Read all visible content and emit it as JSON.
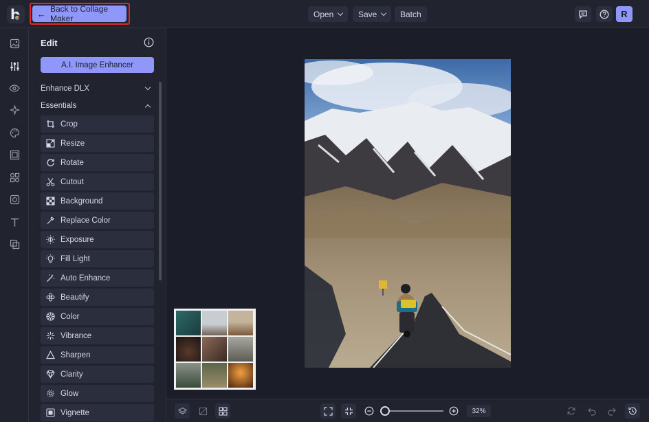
{
  "topbar": {
    "logo_letter": "b",
    "back_label": "Back to Collage Maker",
    "open_label": "Open",
    "save_label": "Save",
    "batch_label": "Batch",
    "avatar_initial": "R"
  },
  "panel": {
    "title": "Edit",
    "ai_button": "A.I. Image Enhancer",
    "sections": {
      "enhance": "Enhance DLX",
      "essentials": "Essentials"
    },
    "tools": [
      {
        "label": "Crop",
        "icon": "crop-icon"
      },
      {
        "label": "Resize",
        "icon": "resize-icon"
      },
      {
        "label": "Rotate",
        "icon": "rotate-icon"
      },
      {
        "label": "Cutout",
        "icon": "cutout-icon"
      },
      {
        "label": "Background",
        "icon": "background-icon"
      },
      {
        "label": "Replace Color",
        "icon": "replace-color-icon"
      },
      {
        "label": "Exposure",
        "icon": "exposure-icon"
      },
      {
        "label": "Fill Light",
        "icon": "fill-light-icon"
      },
      {
        "label": "Auto Enhance",
        "icon": "auto-enhance-icon"
      },
      {
        "label": "Beautify",
        "icon": "beautify-icon"
      },
      {
        "label": "Color",
        "icon": "color-icon"
      },
      {
        "label": "Vibrance",
        "icon": "vibrance-icon"
      },
      {
        "label": "Sharpen",
        "icon": "sharpen-icon"
      },
      {
        "label": "Clarity",
        "icon": "clarity-icon"
      },
      {
        "label": "Glow",
        "icon": "glow-icon"
      },
      {
        "label": "Vignette",
        "icon": "vignette-icon"
      }
    ]
  },
  "bottombar": {
    "zoom_percent": "32%",
    "zoom_level": 0.0
  },
  "colors": {
    "accent": "#8f98f8",
    "highlight_border": "#e3262a",
    "background": "#1b1d28",
    "panel": "#21232f"
  }
}
